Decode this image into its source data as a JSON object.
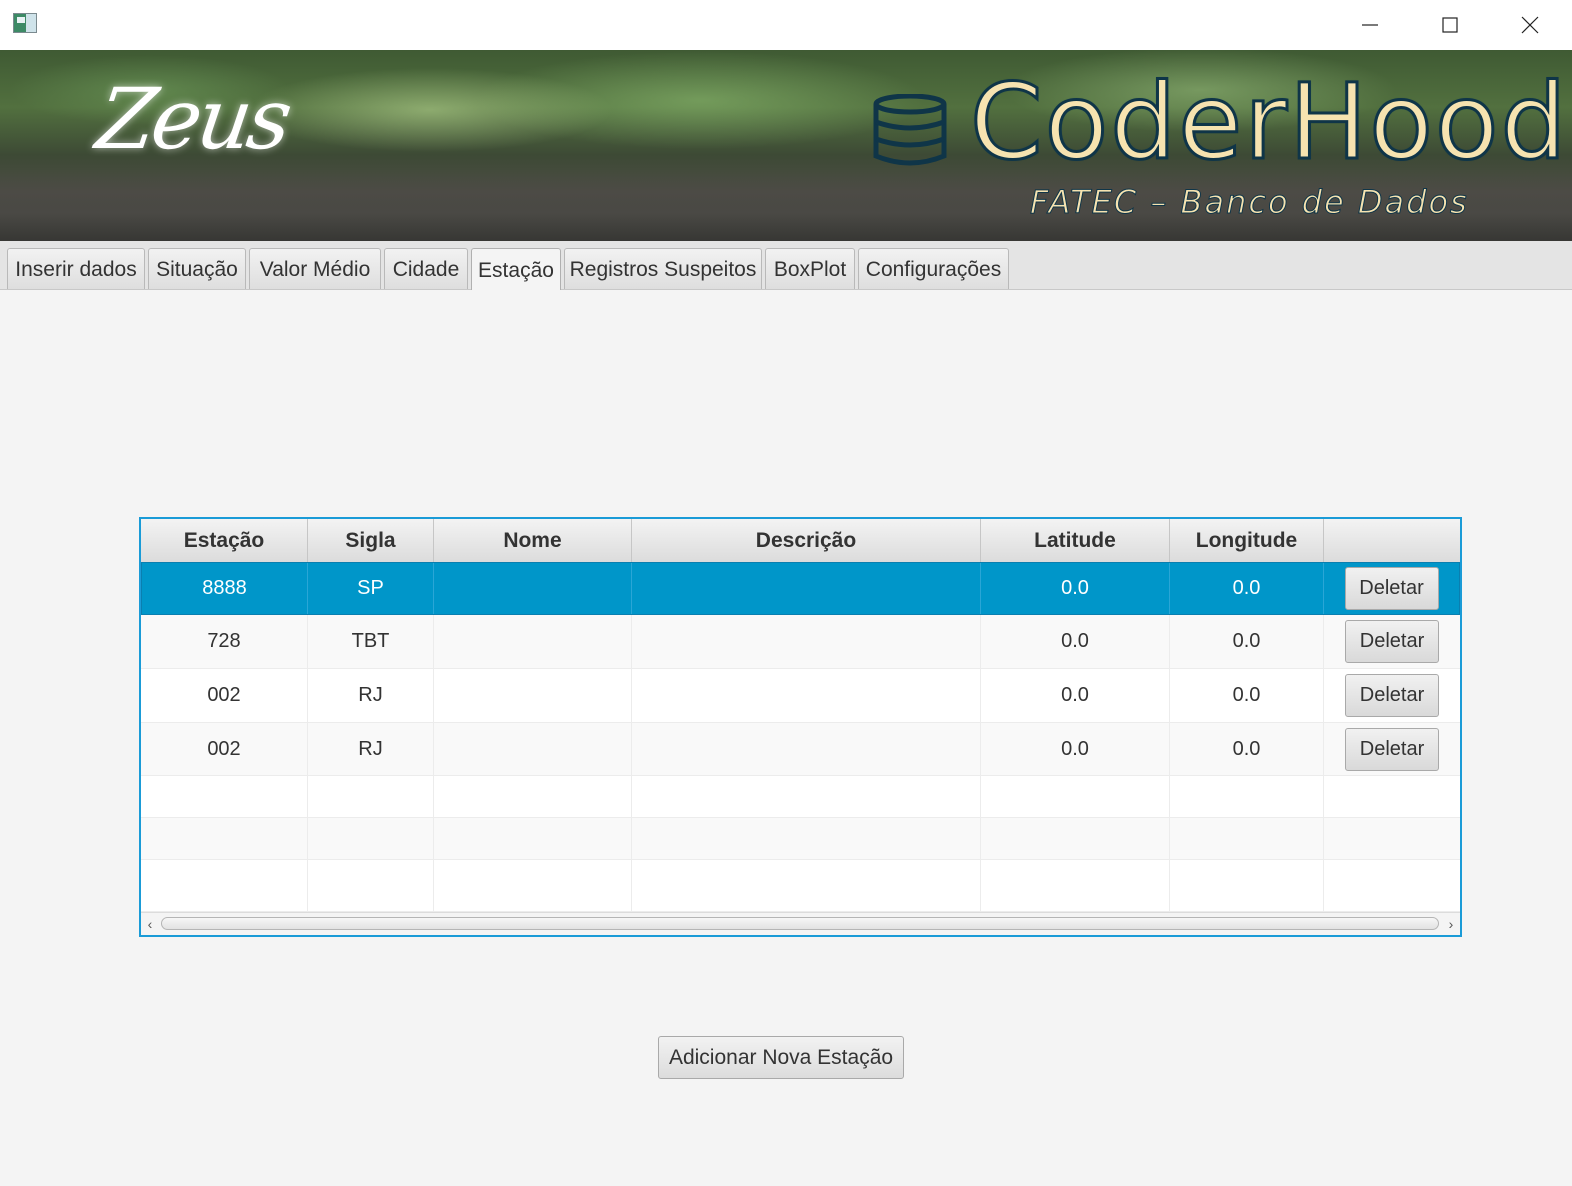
{
  "window": {
    "minimize_icon": "minimize-icon",
    "maximize_icon": "maximize-icon",
    "close_icon": "close-icon"
  },
  "banner": {
    "logo_text": "Zeus",
    "brand_title": "CoderHood",
    "brand_subtitle": "FATEC – Banco de Dados",
    "brand_icon": "database-icon"
  },
  "tabs": [
    {
      "label": "Inserir dados"
    },
    {
      "label": "Situação"
    },
    {
      "label": "Valor Médio"
    },
    {
      "label": "Cidade"
    },
    {
      "label": "Estação",
      "active": true
    },
    {
      "label": "Registros Suspeitos"
    },
    {
      "label": "BoxPlot"
    },
    {
      "label": "Configurações"
    }
  ],
  "table": {
    "columns": [
      "Estação",
      "Sigla",
      "Nome",
      "Descrição",
      "Latitude",
      "Longitude",
      ""
    ],
    "rows": [
      {
        "estacao": "8888",
        "sigla": "SP",
        "nome": "",
        "descricao": "",
        "latitude": "0.0",
        "longitude": "0.0",
        "action": "Deletar",
        "selected": true
      },
      {
        "estacao": "728",
        "sigla": "TBT",
        "nome": "",
        "descricao": "",
        "latitude": "0.0",
        "longitude": "0.0",
        "action": "Deletar"
      },
      {
        "estacao": "002",
        "sigla": "RJ",
        "nome": "",
        "descricao": "",
        "latitude": "0.0",
        "longitude": "0.0",
        "action": "Deletar"
      },
      {
        "estacao": "002",
        "sigla": "RJ",
        "nome": "",
        "descricao": "",
        "latitude": "0.0",
        "longitude": "0.0",
        "action": "Deletar"
      }
    ]
  },
  "add_button": {
    "label": "Adicionar Nova Estação"
  },
  "colors": {
    "selection": "#0096c9",
    "focus_border": "#1a9bd7",
    "brand_text": "#f6e3b0",
    "brand_outline": "#0f3548"
  }
}
